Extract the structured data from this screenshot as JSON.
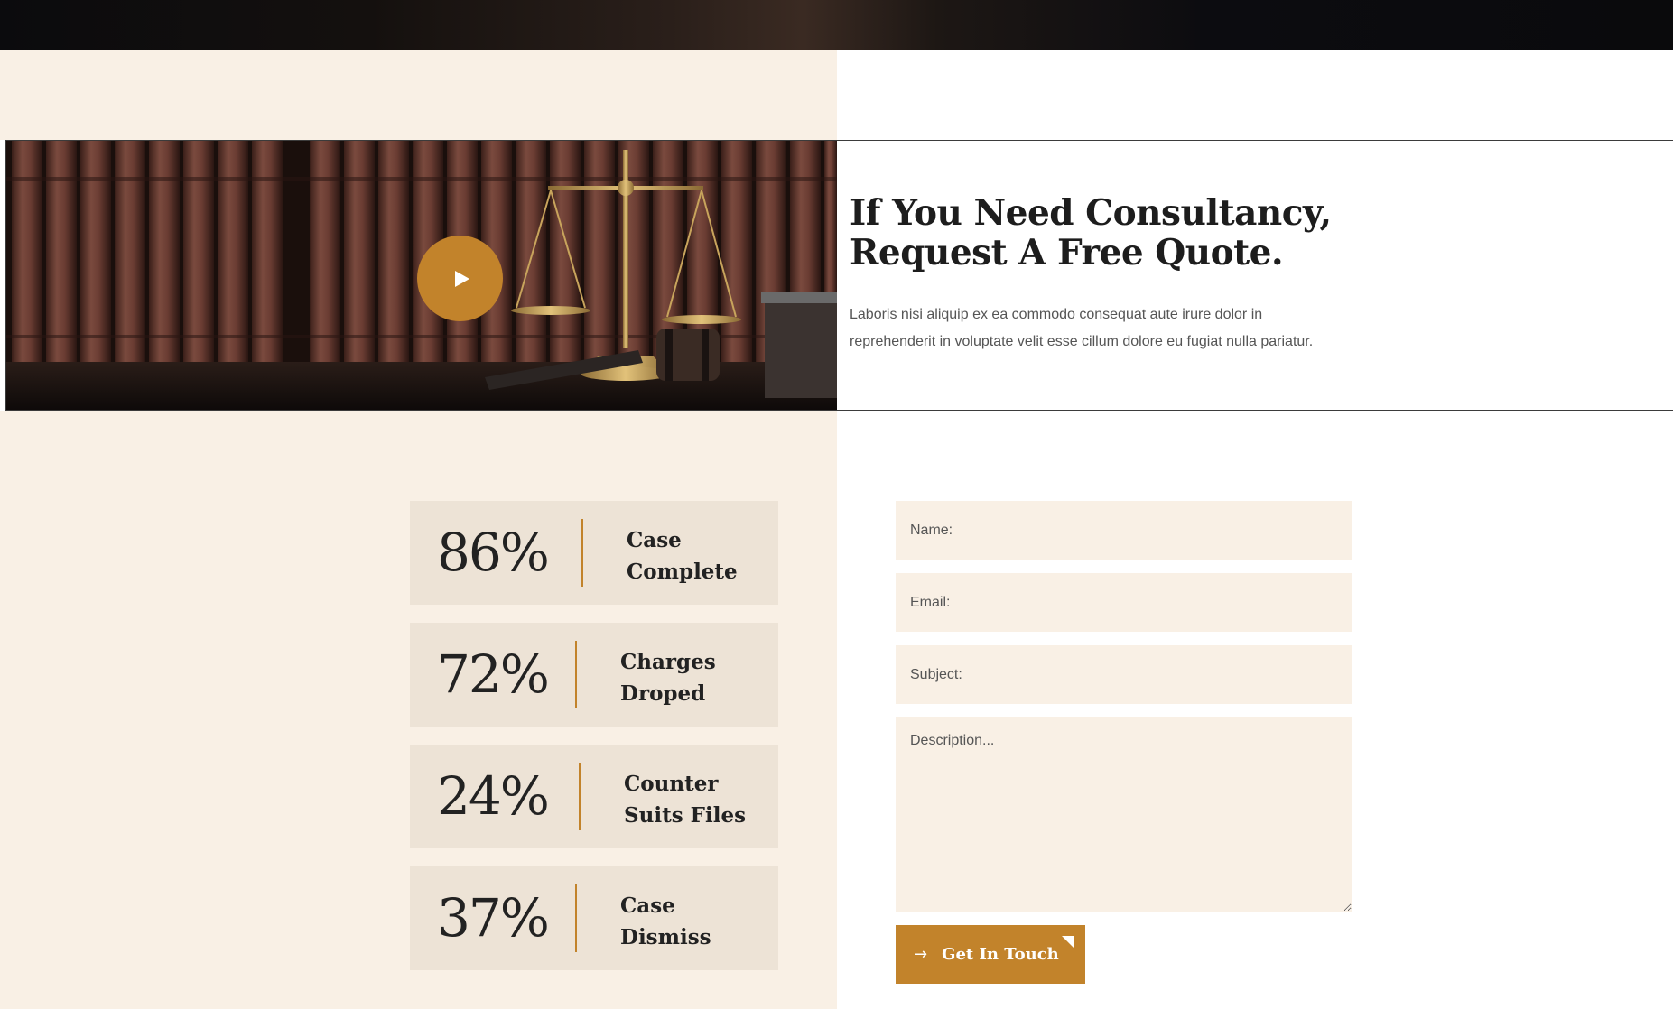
{
  "consultation": {
    "heading_line1": "If You Need Consultancy,",
    "heading_line2": "Request A Free Quote.",
    "lead_line1": "Laboris nisi aliquip ex ea commodo consequat aute irure dolor in",
    "lead_line2": "reprehenderit in voluptate velit esse cillum dolore eu fugiat nulla pariatur."
  },
  "stats": [
    {
      "value": "86%",
      "label_line1": "Case",
      "label_line2": "Complete"
    },
    {
      "value": "72%",
      "label_line1": "Charges",
      "label_line2": "Droped"
    },
    {
      "value": "24%",
      "label_line1": "Counter",
      "label_line2": "Suits Files"
    },
    {
      "value": "37%",
      "label_line1": "Case",
      "label_line2": "Dismiss"
    }
  ],
  "form": {
    "name_placeholder": "Name:",
    "email_placeholder": "Email:",
    "subject_placeholder": "Subject:",
    "description_placeholder": "Description...",
    "submit_label": "Get In Touch"
  },
  "icons": {
    "play": "play-icon",
    "arrow": "arrow-right-icon",
    "corner": "corner-triangle-icon"
  },
  "colors": {
    "accent": "#c2832b",
    "cream": "#f9f0e5",
    "stat_bg": "#ede3d6",
    "text_dark": "#1d1d1d"
  }
}
